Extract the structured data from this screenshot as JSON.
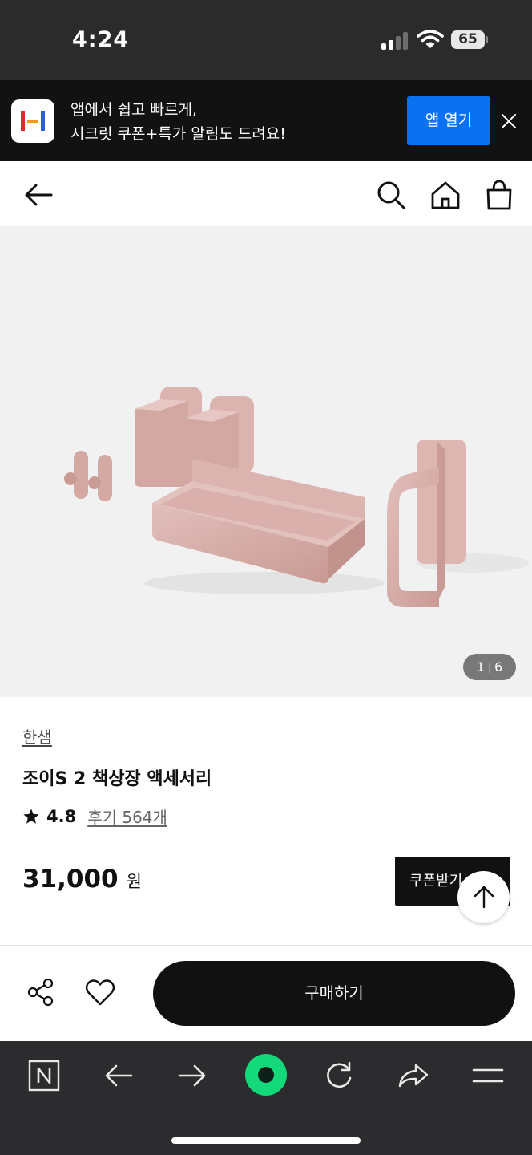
{
  "status_bar": {
    "time": "4:24",
    "battery": "65"
  },
  "app_banner": {
    "line1": "앱에서 쉽고 빠르게,",
    "line2": "시크릿 쿠폰+특가 알림도 드려요!",
    "open_button": "앱 열기"
  },
  "image_counter": {
    "current": "1",
    "total": "6"
  },
  "product": {
    "brand": "한샘",
    "title": "조이S 2 책상장 액세서리",
    "rating": "4.8",
    "reviews": "후기 564개",
    "price": "31,000",
    "currency": "원",
    "coupon_button": "쿠폰받기"
  },
  "actions": {
    "buy_button": "구매하기"
  },
  "colors": {
    "accent_blue": "#0a72f0",
    "product_pink": "#d9b0ab",
    "browser_green": "#14d97a",
    "dark": "#111111"
  }
}
